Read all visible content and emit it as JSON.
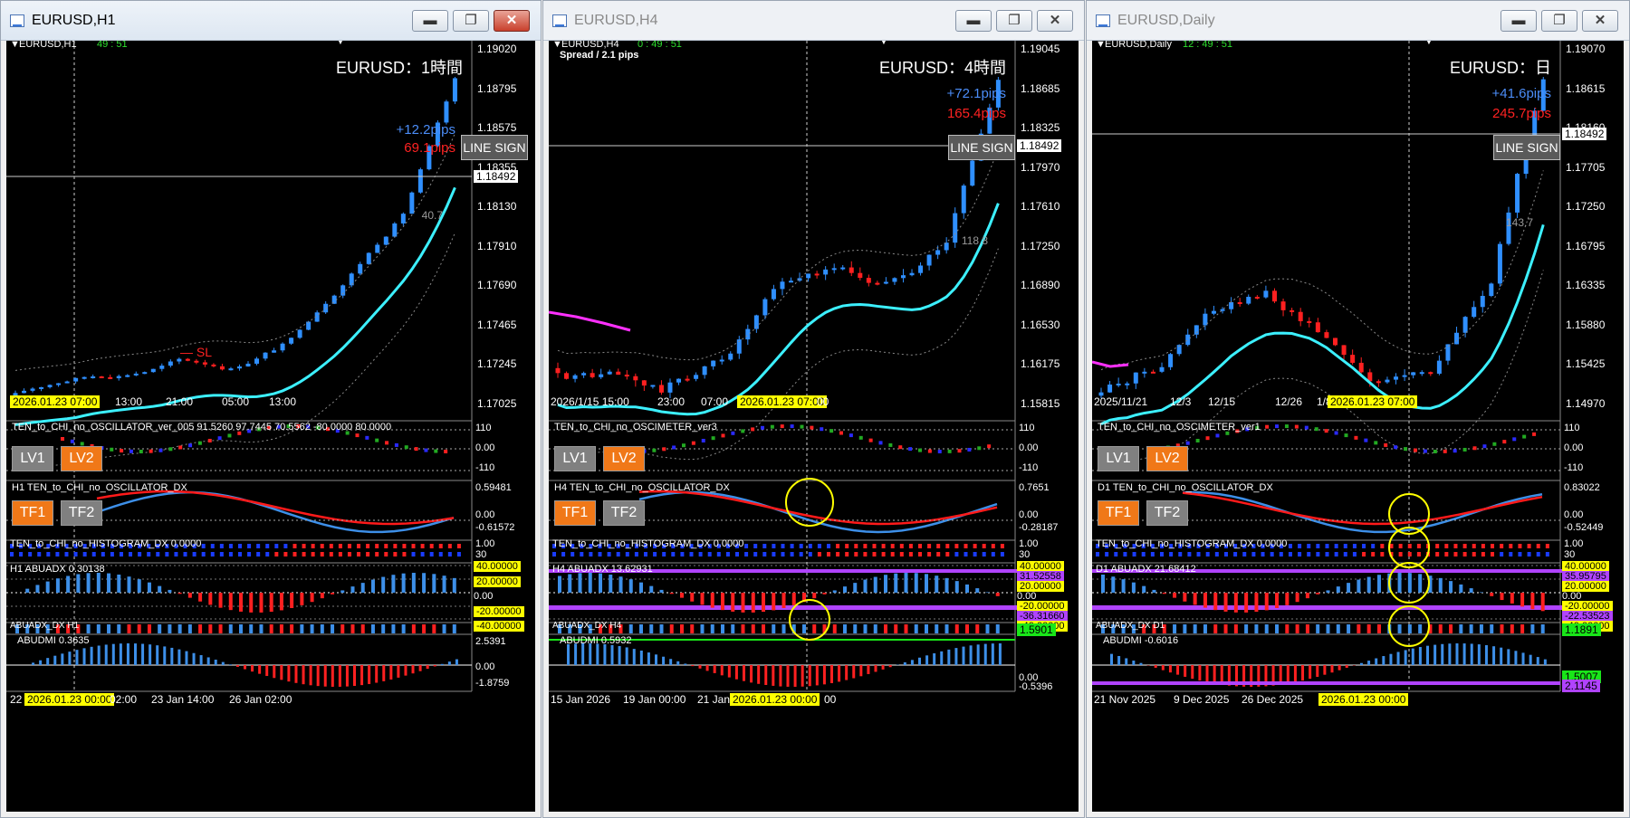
{
  "windows": [
    {
      "title": "EURUSD,H1",
      "active": true,
      "header": "EURUSD,H1",
      "timer": "49 : 51",
      "spread": "",
      "big_label": "EURUSD：1時間",
      "plus_pips": "+12.2pips",
      "minus_pips": "69.1pips",
      "line_sign": "LINE SIGN",
      "atr": "40.7",
      "current_price": "1.18492",
      "sl": "— SL",
      "price_axis": [
        "1.19020",
        "1.18795",
        "1.18575",
        "1.18355",
        "1.18130",
        "1.17910",
        "1.17690",
        "1.17465",
        "1.17245",
        "1.17025"
      ],
      "time_axis": [
        "2026.01.23 07:00",
        "13:00",
        "21:00",
        "05:00",
        "13:00"
      ],
      "osc1_title": "TEN_to_CHI_no_OSCILLATOR_ver_005  91.5260 97.7445 70.5562 -80.0000 80.0000",
      "osc1_levels": [
        "110",
        "0.00",
        "-110"
      ],
      "osc2_title": "H1 TEN_to_CHI_no_OSCILLATOR_DX",
      "osc2_levels": [
        "0.59481",
        "0.00",
        "-0.61572"
      ],
      "hist_title": "TEN_to_CHI_no_HISTOGRAM_DX 0.0000",
      "hist_levels": [
        "1.00",
        "30"
      ],
      "adx_title": "H1 ABUADX  0.30138",
      "adx_levels": [
        "40.00000",
        "20.00000",
        "0.00",
        "-20.00000",
        "-40.00000"
      ],
      "adxdx_title": "ABUADX_DX H1",
      "dmi_title": "ABUDMI  0.3635",
      "dmi_levels": [
        "2.5391",
        "0.00",
        "-1.8759"
      ],
      "bottom_axis": [
        "22 Jan",
        "2026.01.23 00:00",
        "02:00",
        "23 Jan 14:00",
        "26 Jan 02:00"
      ],
      "buttons": {
        "lv1": "LV1",
        "lv2": "LV2",
        "tf1": "TF1",
        "tf2": "TF2"
      }
    },
    {
      "title": "EURUSD,H4",
      "active": false,
      "header": "EURUSD,H4",
      "timer": "0 : 49 : 51",
      "spread": "Spread / 2.1 pips",
      "big_label": "EURUSD：4時間",
      "plus_pips": "+72.1pips",
      "minus_pips": "165.4pips",
      "line_sign": "LINE SIGN",
      "atr": "118.8",
      "current_price": "1.18492",
      "sl": "",
      "price_axis": [
        "1.19045",
        "1.18685",
        "1.18325",
        "1.17970",
        "1.17610",
        "1.17250",
        "1.16890",
        "1.16530",
        "1.16175",
        "1.15815"
      ],
      "time_axis": [
        "2026/1/15 15:00",
        "23:00",
        "07:00",
        "2026.01.23 07:00",
        "00"
      ],
      "osc1_title": "TEN_to_CHI_no_OSCIMETER_ver3",
      "osc1_levels": [
        "110",
        "0.00",
        "-110"
      ],
      "osc2_title": "H4 TEN_to_CHI_no_OSCILLATOR_DX",
      "osc2_levels": [
        "0.7651",
        "0.00",
        "-0.28187"
      ],
      "hist_title": "TEN_to_CHI_no_HISTOGRAM_DX 0.0000",
      "hist_levels": [
        "1.00",
        "30"
      ],
      "adx_title": "H4 ABUADX  13.62931",
      "adx_levels": [
        "40.00000",
        "31.52558",
        "20.00000",
        "0.00",
        "-20.00000",
        "-36.31660",
        "-40.00000"
      ],
      "adxdx_title": "ABUADX_DX H4",
      "adxdx_level": "1.5901",
      "dmi_title": "ABUDMI  0.5932",
      "dmi_levels": [
        "0.00",
        "-0.5396"
      ],
      "bottom_axis": [
        "15 Jan 2026",
        "19 Jan 00:00",
        "21 Jan",
        "2026.01.23 00:00",
        "00"
      ],
      "buttons": {
        "lv1": "LV1",
        "lv2": "LV2",
        "tf1": "TF1",
        "tf2": "TF2"
      }
    },
    {
      "title": "EURUSD,Daily",
      "active": false,
      "header": "EURUSD,Daily",
      "timer": "12 : 49 : 51",
      "spread": "",
      "big_label": "EURUSD：日",
      "plus_pips": "+41.6pips",
      "minus_pips": "245.7pips",
      "line_sign": "LINE SIGN",
      "atr": "143.7",
      "current_price": "1.18492",
      "sl": "",
      "price_axis": [
        "1.19070",
        "1.18615",
        "1.18160",
        "1.17705",
        "1.17250",
        "1.16795",
        "1.16335",
        "1.15880",
        "1.15425",
        "1.14970"
      ],
      "time_axis": [
        "2025/11/21",
        "12/3",
        "12/15",
        "12/26",
        "1/8",
        "2026.01.23 07:00"
      ],
      "osc1_title": "TEN_to_CHI_no_OSCIMETER_ver1",
      "osc1_levels": [
        "110",
        "0.00",
        "-110"
      ],
      "osc2_title": "D1 TEN_to_CHI_no_OSCILLATOR_DX",
      "osc2_levels": [
        "0.83022",
        "0.00",
        "-0.52449"
      ],
      "hist_title": "TEN_to_CHI_no_HISTOGRAM_DX 0.0000",
      "hist_levels": [
        "1.00",
        "30"
      ],
      "adx_title": "D1 ABUADX  21.68412",
      "adx_levels": [
        "40.00000",
        "35.95795",
        "20.00000",
        "0.00",
        "-20.00000",
        "-22.53523",
        "-40.00000"
      ],
      "adxdx_title": "ABUADX_DX D1",
      "adxdx_level": "1.1891",
      "dmi_title": "ABUDMI  -0.6016",
      "dmi_levels": [
        "1.5007",
        "2.1145"
      ],
      "bottom_axis": [
        "21 Nov 2025",
        "9 Dec 2025",
        "26 Dec 2025",
        "2026.01.23 00:00"
      ],
      "buttons": {
        "lv1": "LV1",
        "lv2": "LV2",
        "tf1": "TF1",
        "tf2": "TF2"
      }
    }
  ],
  "colors": {
    "bull": "#2f8fff",
    "bear": "#ff2020",
    "ma": "#3cf0ff",
    "magenta": "#ff30ff",
    "orange": "#f07818",
    "yellow": "#ffff00"
  }
}
